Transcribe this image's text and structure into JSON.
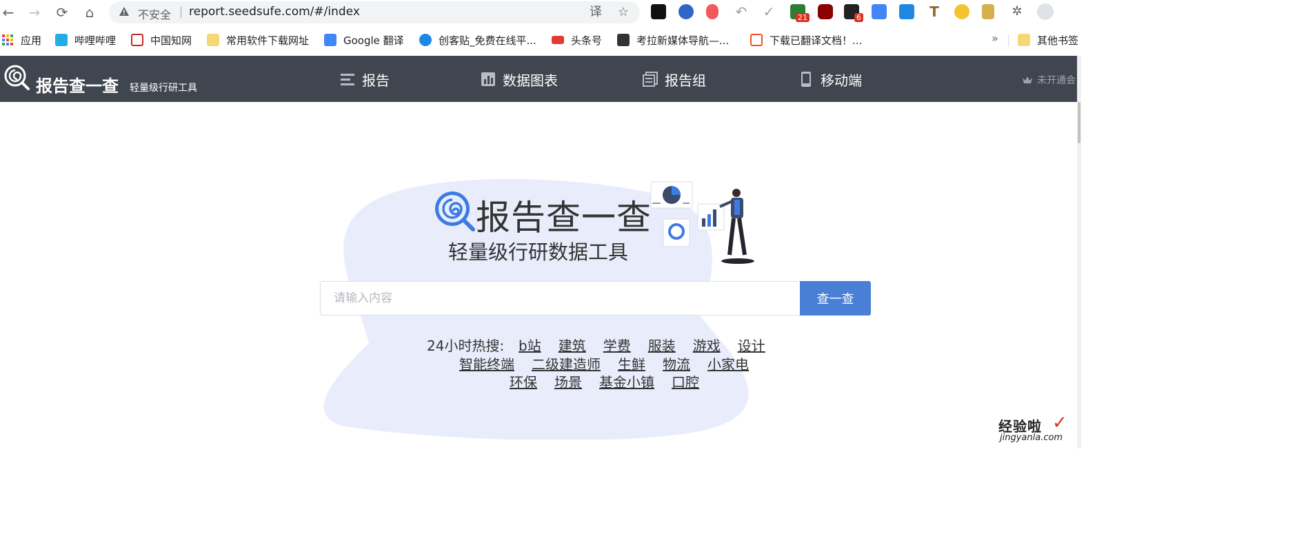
{
  "browser": {
    "security_label": "不安全",
    "url": "report.seedsufe.com/#/index",
    "extension_badges": {
      "ext_a": "21",
      "ext_b": "6"
    }
  },
  "bookmarks": {
    "items": [
      {
        "label": "应用",
        "icon": "apps-grid-icon"
      },
      {
        "label": "哔哩哔哩",
        "icon": "bilibili-icon"
      },
      {
        "label": "中国知网",
        "icon": "cnki-icon"
      },
      {
        "label": "常用软件下载网址",
        "icon": "folder-icon"
      },
      {
        "label": "Google 翻译",
        "icon": "google-translate-icon"
      },
      {
        "label": "创客贴_免费在线平...",
        "icon": "chuangkit-icon"
      },
      {
        "label": "头条号",
        "icon": "toutiao-icon"
      },
      {
        "label": "考拉新媒体导航—...",
        "icon": "koala-icon"
      },
      {
        "label": "下载已翻译文档！...",
        "icon": "translate-doc-icon"
      }
    ],
    "more": "»",
    "other": "其他书签"
  },
  "header": {
    "logo_text": "报告查一查",
    "logo_sub": "轻量级行研工具",
    "nav": [
      {
        "label": "报告",
        "icon": "list-icon"
      },
      {
        "label": "数据图表",
        "icon": "bar-chart-icon"
      },
      {
        "label": "报告组",
        "icon": "report-group-icon"
      },
      {
        "label": "移动端",
        "icon": "mobile-icon"
      }
    ],
    "vip_label": "未开通会"
  },
  "hero": {
    "title": "报告查一查",
    "subtitle": "轻量级行研数据工具"
  },
  "search": {
    "placeholder": "请输入内容",
    "button": "查一查"
  },
  "hot": {
    "label": "24小时热搜:",
    "line1": [
      "b站",
      "建筑",
      "学费",
      "服装",
      "游戏",
      "设计"
    ],
    "line2": [
      "智能终端",
      "二级建造师",
      "生鲜",
      "物流",
      "小家电"
    ],
    "line3": [
      "环保",
      "场景",
      "基金小镇",
      "口腔"
    ]
  },
  "watermark": {
    "top": "经验啦",
    "bottom": "jingyanla.com"
  },
  "colors": {
    "header_bg": "#40464f",
    "accent": "#4a7fd6",
    "blob": "#e8ecfb"
  }
}
